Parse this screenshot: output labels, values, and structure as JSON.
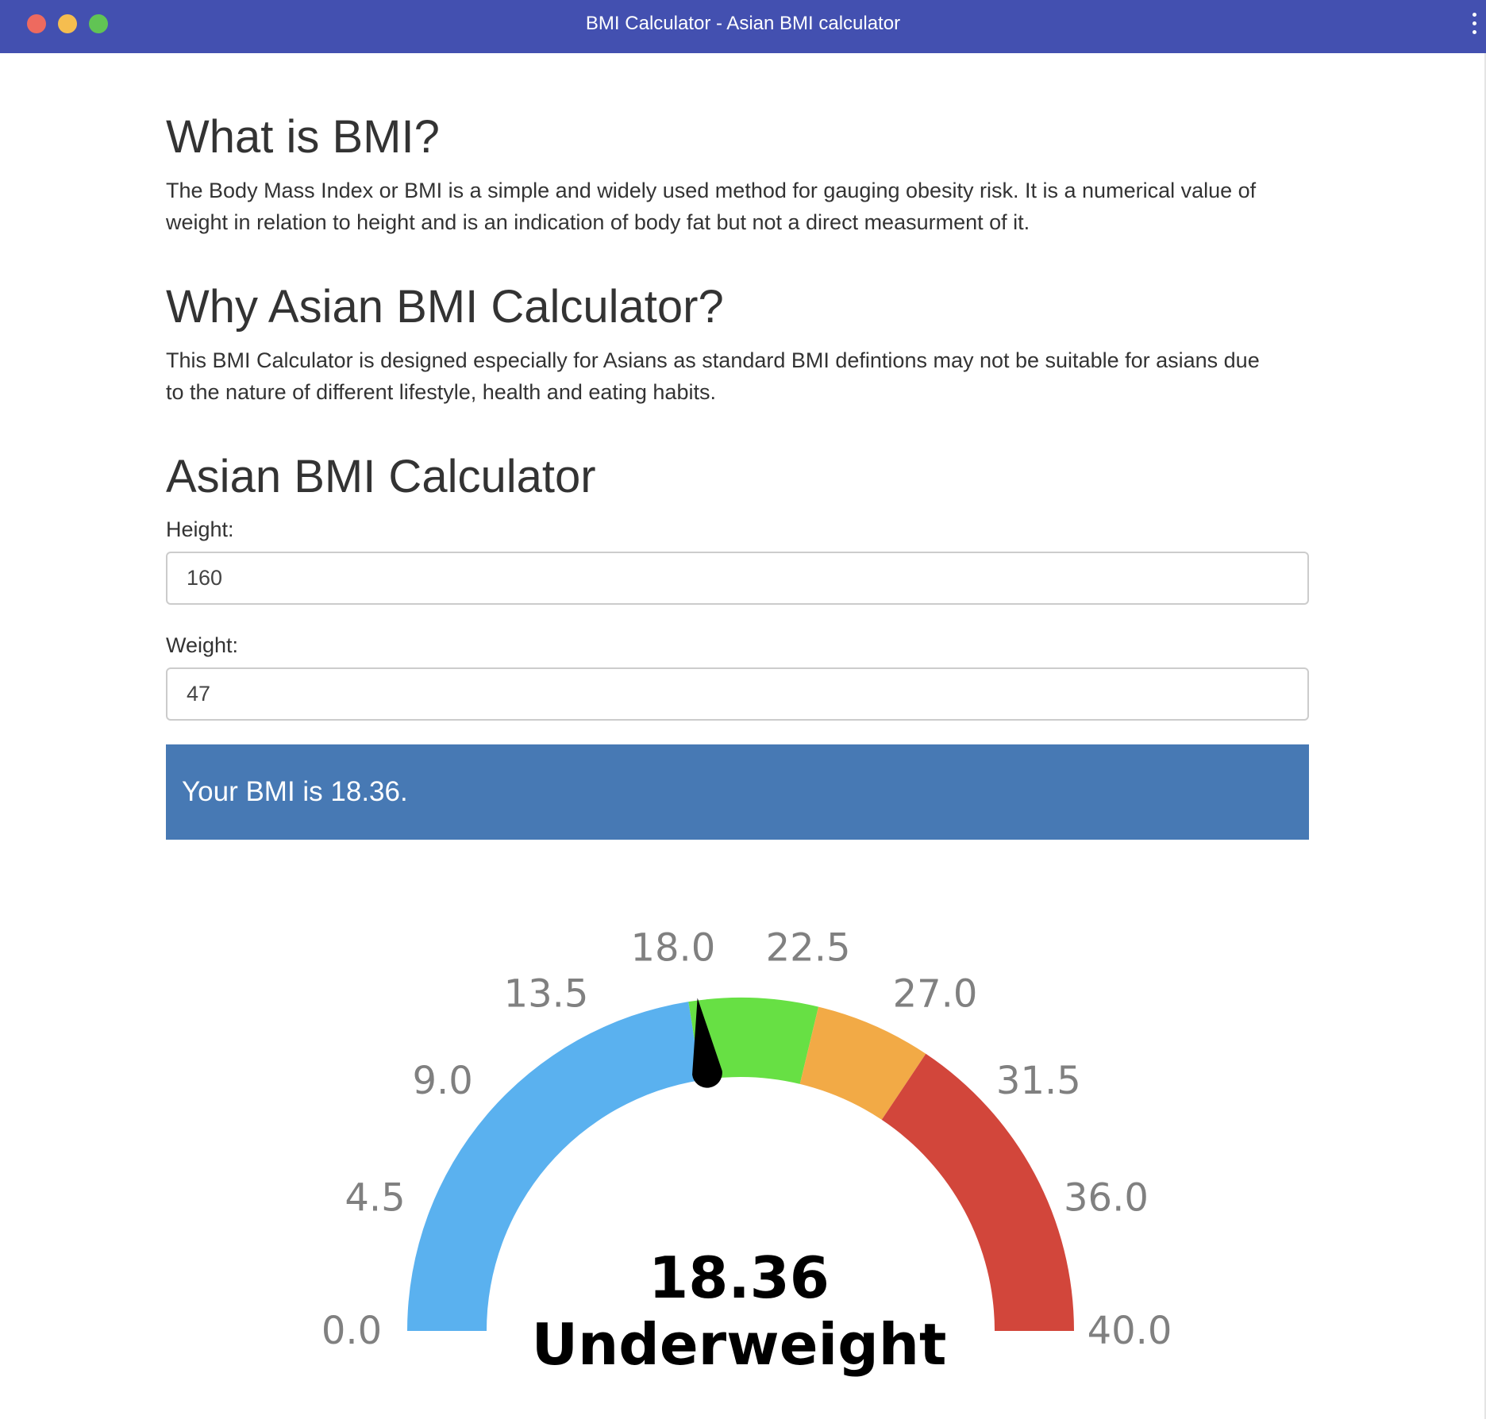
{
  "window": {
    "title": "BMI Calculator - Asian BMI calculator"
  },
  "sections": {
    "what": {
      "heading": "What is BMI?",
      "line1": "The Body Mass Index or BMI is a simple and widely used method for gauging obesity risk. It is a numerical value of",
      "line2": "weight in relation to height and is an indication of body fat but not a direct measurment of it."
    },
    "why": {
      "heading": "Why Asian BMI Calculator?",
      "line1": "This BMI Calculator is designed especially for Asians as standard BMI defintions may not be suitable for asians due",
      "line2": "to the nature of different lifestyle, health and eating habits."
    },
    "calculator": {
      "heading": "Asian BMI Calculator",
      "height_label": "Height:",
      "height_value": "160",
      "weight_label": "Weight:",
      "weight_value": "47",
      "result_text": "Your BMI is 18.36."
    }
  },
  "gauge": {
    "min": 0,
    "max": 40,
    "value": 18.36,
    "value_text": "18.36",
    "category": "Underweight",
    "tick_labels": [
      "0.0",
      "4.5",
      "9.0",
      "13.5",
      "18.0",
      "22.5",
      "27.0",
      "31.5",
      "36.0",
      "40.0"
    ],
    "bands": [
      {
        "from": 0,
        "to": 18,
        "color": "#5ab1ef"
      },
      {
        "from": 18,
        "to": 23,
        "color": "#67e044"
      },
      {
        "from": 23,
        "to": 27.5,
        "color": "#f2aa46"
      },
      {
        "from": 27.5,
        "to": 40,
        "color": "#d2463b"
      }
    ],
    "needle_color": "#000000",
    "label_color": "#808080"
  },
  "colors": {
    "titlebar": "#4350b0",
    "result_bar": "#4779b4"
  }
}
